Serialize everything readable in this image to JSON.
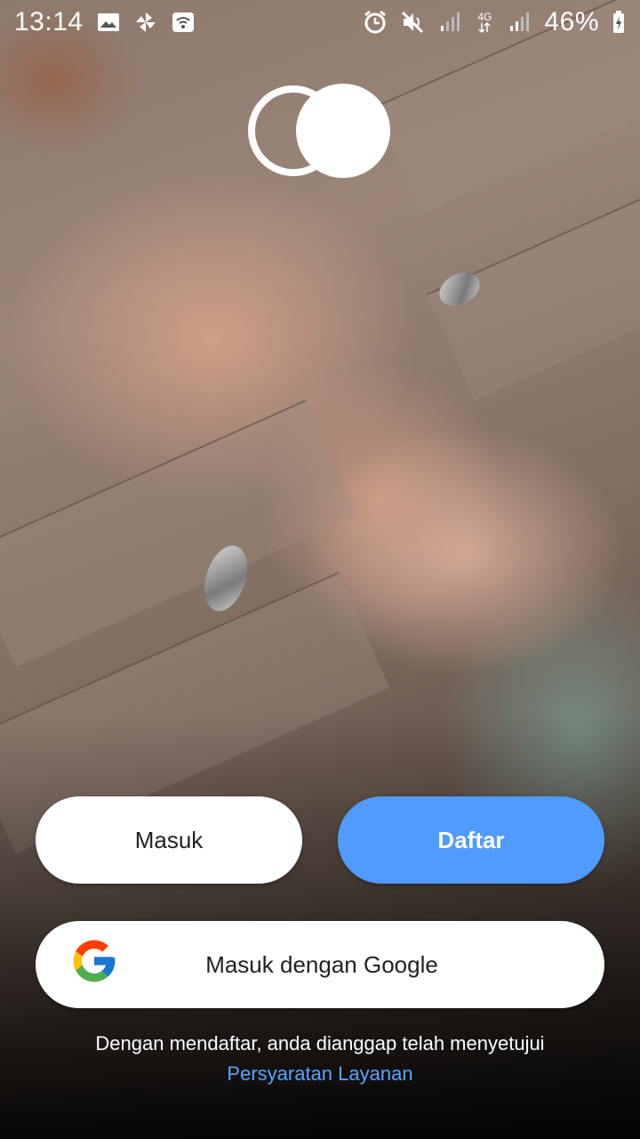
{
  "status_bar": {
    "time": "13:14",
    "network": "4G",
    "battery": "46%"
  },
  "logo": {
    "icon": "two-circles-logo"
  },
  "buttons": {
    "login_label": "Masuk",
    "register_label": "Daftar",
    "google_label": "Masuk dengan Google"
  },
  "terms": {
    "text": "Dengan mendaftar, anda dianggap telah menyetujui",
    "link": "Persyaratan Layanan"
  },
  "colors": {
    "accent": "#4f9bff",
    "link": "#5aa5ff"
  }
}
